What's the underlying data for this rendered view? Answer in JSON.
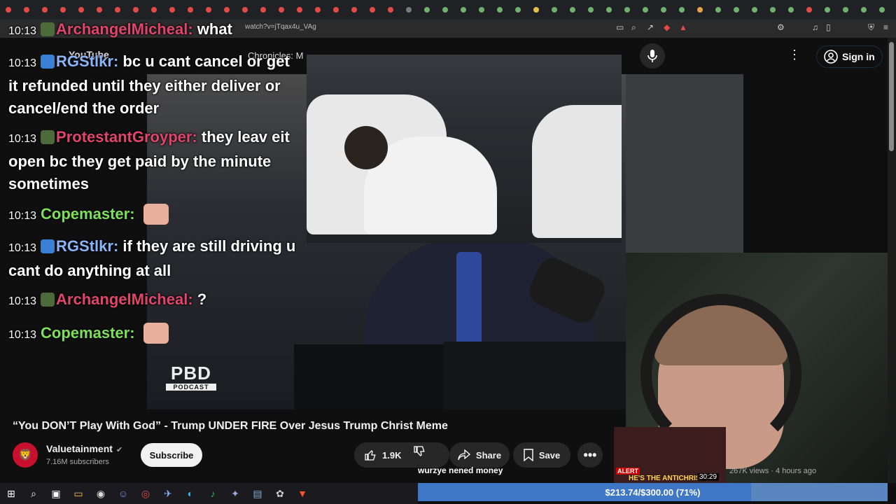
{
  "browser": {
    "url": "watch?v=jTqax4u_VAg",
    "tab_colors": [
      "#e34b4b",
      "#e34b4b",
      "#e34b4b",
      "#e34b4b",
      "#e34b4b",
      "#e34b4b",
      "#e34b4b",
      "#e34b4b",
      "#e34b4b",
      "#e34b4b",
      "#e34b4b",
      "#e34b4b",
      "#e34b4b",
      "#e34b4b",
      "#e34b4b",
      "#e34b4b",
      "#e34b4b",
      "#e34b4b",
      "#e34b4b",
      "#e34b4b",
      "#e34b4b",
      "#e34b4b",
      "#7a7a7a",
      "#6fb06f",
      "#6fb06f",
      "#6fb06f",
      "#6fb06f",
      "#6fb06f",
      "#6fb06f",
      "#e3c04b",
      "#6fb06f",
      "#6fb06f",
      "#6fb06f",
      "#6fb06f",
      "#6fb06f",
      "#6fb06f",
      "#6fb06f",
      "#6fb06f",
      "#e3a04b",
      "#6fb06f",
      "#6fb06f",
      "#6fb06f",
      "#6fb06f",
      "#6fb06f",
      "#e34b4b",
      "#6fb06f",
      "#6fb06f",
      "#6fb06f",
      "#6fb06f",
      "#6fb06f",
      "#6fb06f"
    ]
  },
  "youtube": {
    "logo": "YouTube",
    "search_text": "Chronicles: M",
    "signin": "Sign in"
  },
  "chat": [
    {
      "time": "10:13",
      "user": "ArchangelMicheal:",
      "user_color": "#e2456b",
      "text": "what"
    },
    {
      "time": "10:13",
      "user": "RGStlkr:",
      "user_color": "#8ab4f8",
      "text": "bc u cant cancel or get it refunded until they either deliver or cancel/end the order"
    },
    {
      "time": "10:13",
      "user": "ProtestantGroyper:",
      "user_color": "#e2456b",
      "text": "they leav eit open bc they get paid by the minute sometimes"
    },
    {
      "time": "10:13",
      "user": "Copemaster:",
      "user_color": "#7ee05a",
      "text": ""
    },
    {
      "time": "10:13",
      "user": "RGStlkr:",
      "user_color": "#8ab4f8",
      "text": "if they are still driving u cant do anything at all"
    },
    {
      "time": "10:13",
      "user": "ArchangelMicheal:",
      "user_color": "#e2456b",
      "text": "?"
    },
    {
      "time": "10:13",
      "user": "Copemaster:",
      "user_color": "#7ee05a",
      "text": ""
    }
  ],
  "video": {
    "watermark_big": "PBD",
    "watermark_small": "PODCAST",
    "title": "“You DON’T Play With God” - Trump UNDER FIRE Over Jesus Trump Christ Meme"
  },
  "channel": {
    "name": "Valuetainment",
    "subscribers": "7.16M subscribers",
    "subscribe_label": "Subscribe"
  },
  "actions": {
    "likes": "1.9K",
    "share": "Share",
    "save": "Save"
  },
  "caption": "wurzye nened money",
  "related": {
    "alert": "ALERT",
    "title_text": "HE'S THE ANTICHRIS",
    "duration": "30:29",
    "meta": "267K views · 4 hours ago"
  },
  "goal": {
    "text": "$213.74/$300.00 (71%)",
    "progress": 0.71
  },
  "taskbar": {
    "icons": [
      "windows-icon",
      "search-icon",
      "task-view-icon",
      "file-explorer-icon",
      "obs-icon",
      "discord-icon",
      "chrome-icon",
      "app-icon",
      "edge-icon",
      "spotify-icon",
      "app2-icon",
      "notepad-icon",
      "app3-icon",
      "brave-icon"
    ]
  }
}
